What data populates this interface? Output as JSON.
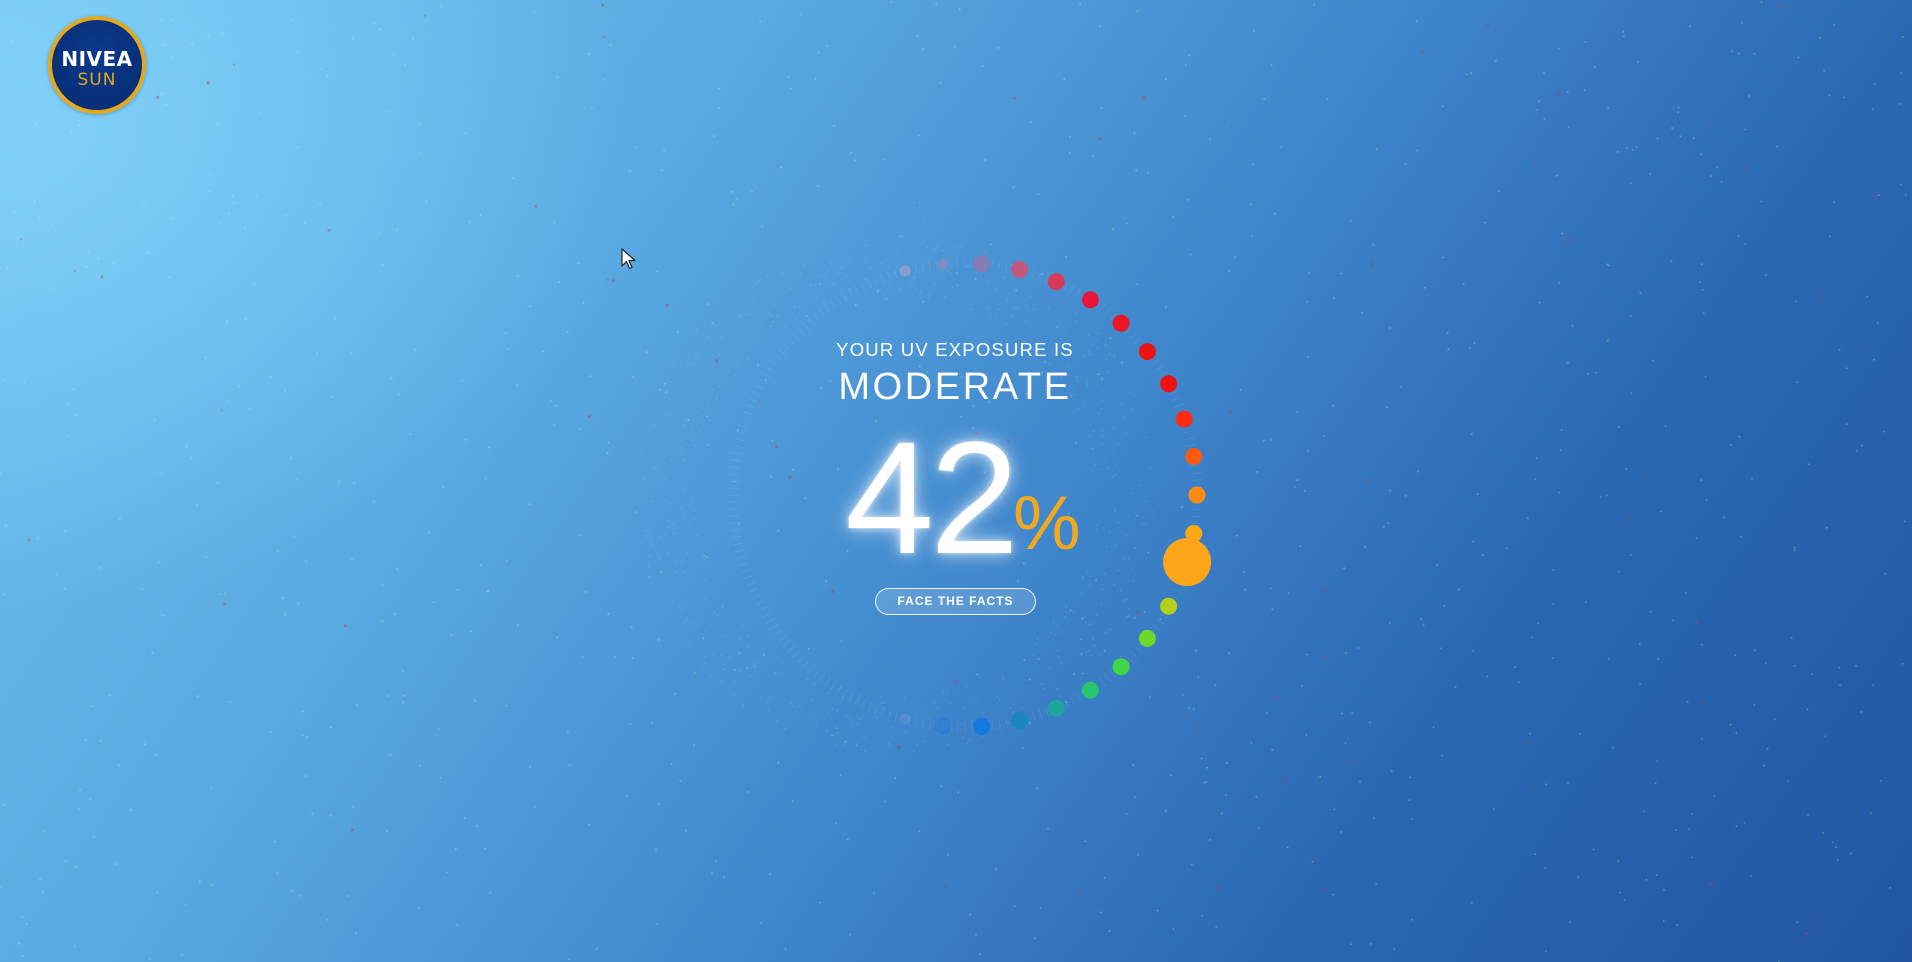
{
  "logo": {
    "brand": "NIVEA",
    "sub": "SUN",
    "colors": {
      "ring": "#e5a81a",
      "fill": "#0a3a8e"
    }
  },
  "exposure": {
    "heading": "YOUR UV EXPOSURE IS",
    "level": "MODERATE",
    "percent_value": "42",
    "percent_sign": "%",
    "percent": 42,
    "accent_color": "#f2a91d"
  },
  "button": {
    "label": "FACE THE FACTS"
  },
  "dial": {
    "dot_colors_top_to_bottom": [
      "#b9a3c7",
      "#a984b4",
      "#b76b9c",
      "#c4577b",
      "#d83a5a",
      "#e6173a",
      "#ee1525",
      "#ea1414",
      "#f01212",
      "#ff2a12",
      "#ff5a10",
      "#ff8a10",
      "#ffa813",
      "#ffb10f",
      "#b3cf1a",
      "#6ed72a",
      "#3fd746",
      "#27c66e",
      "#20a59a",
      "#1a86c2",
      "#1378e0",
      "#2a79d8",
      "#5f95d4"
    ],
    "indicator_color": "#ffa51a"
  },
  "cursor": {
    "icon": "mouse-pointer-icon"
  }
}
